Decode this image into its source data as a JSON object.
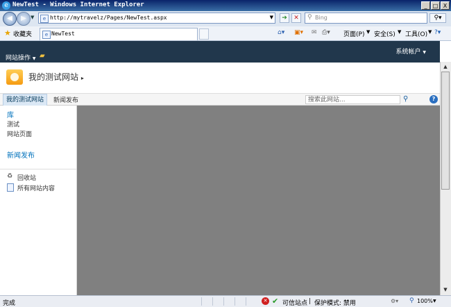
{
  "window": {
    "title": "NewTest - Windows Internet Explorer",
    "min": "_",
    "max": "□",
    "close": "X"
  },
  "nav": {
    "address": "http://mytravelz/Pages/NewTest.aspx",
    "search_placeholder": "Bing"
  },
  "favbar": {
    "favorites_label": "收藏夹",
    "tab_title": "NewTest",
    "page_menu": "页面(P)",
    "safety_menu": "安全(S)",
    "tools_menu": "工具(O)"
  },
  "sharepoint": {
    "site_actions": "网站操作",
    "system_account": "系统帐户",
    "site_title": "我的测试网站",
    "topnav": [
      "我的测试网站",
      "新闻发布"
    ],
    "search_placeholder": "搜索此网站...",
    "leftnav": {
      "heading_libraries": "库",
      "items": [
        "测试",
        "网站页面"
      ],
      "heading_news": "新闻发布",
      "recycle_bin": "回收站",
      "all_content": "所有网站内容"
    }
  },
  "status": {
    "done": "完成",
    "trusted": "可信站点",
    "separator": "|",
    "protected": "保护模式: 禁用",
    "zoom": "100%"
  },
  "colors": {
    "ribbon": "#21374c",
    "content_gray": "#808080",
    "link_blue": "#0072bc"
  }
}
